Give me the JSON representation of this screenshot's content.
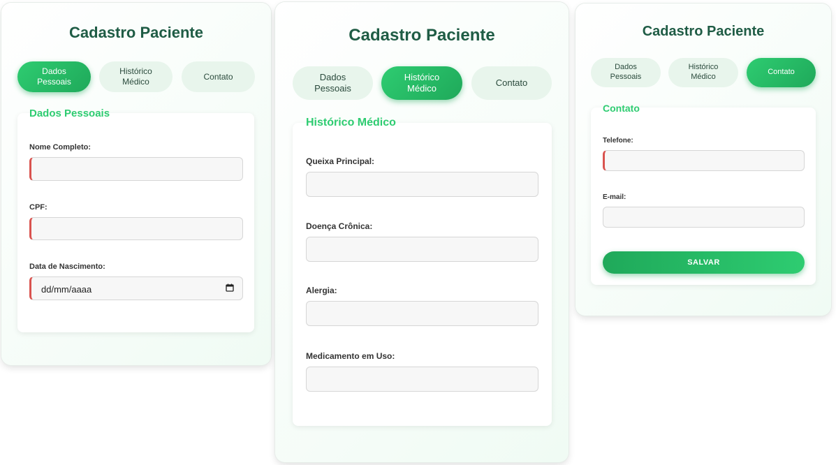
{
  "colors": {
    "accent": "#2ecc71",
    "accent_dark": "#1fa95a",
    "title": "#1f5c45",
    "required_marker": "#d9534f"
  },
  "screens": [
    {
      "title": "Cadastro Paciente",
      "tabs": [
        {
          "label": "Dados Pessoais",
          "active": true
        },
        {
          "label": "Histórico Médico",
          "active": false
        },
        {
          "label": "Contato",
          "active": false
        }
      ],
      "section_title": "Dados Pessoais",
      "fields": [
        {
          "label": "Nome Completo:",
          "value": "",
          "required": true
        },
        {
          "label": "CPF:",
          "value": "",
          "required": true
        },
        {
          "label": "Data de Nascimento:",
          "placeholder": "dd/mm/aaaa",
          "icon": "calendar-icon",
          "required": true
        }
      ]
    },
    {
      "title": "Cadastro Paciente",
      "tabs": [
        {
          "label": "Dados Pessoais",
          "active": false
        },
        {
          "label": "Histórico Médico",
          "active": true
        },
        {
          "label": "Contato",
          "active": false
        }
      ],
      "section_title": "Histórico Médico",
      "fields": [
        {
          "label": "Queixa Principal:",
          "value": ""
        },
        {
          "label": "Doença Crônica:",
          "value": ""
        },
        {
          "label": "Alergia:",
          "value": ""
        },
        {
          "label": "Medicamento em Uso:",
          "value": ""
        }
      ]
    },
    {
      "title": "Cadastro Paciente",
      "tabs": [
        {
          "label": "Dados Pessoais",
          "active": false
        },
        {
          "label": "Histórico Médico",
          "active": false
        },
        {
          "label": "Contato",
          "active": true
        }
      ],
      "section_title": "Contato",
      "fields": [
        {
          "label": "Telefone:",
          "value": "",
          "required": true
        },
        {
          "label": "E-mail:",
          "value": ""
        }
      ],
      "save_label": "SALVAR"
    }
  ]
}
